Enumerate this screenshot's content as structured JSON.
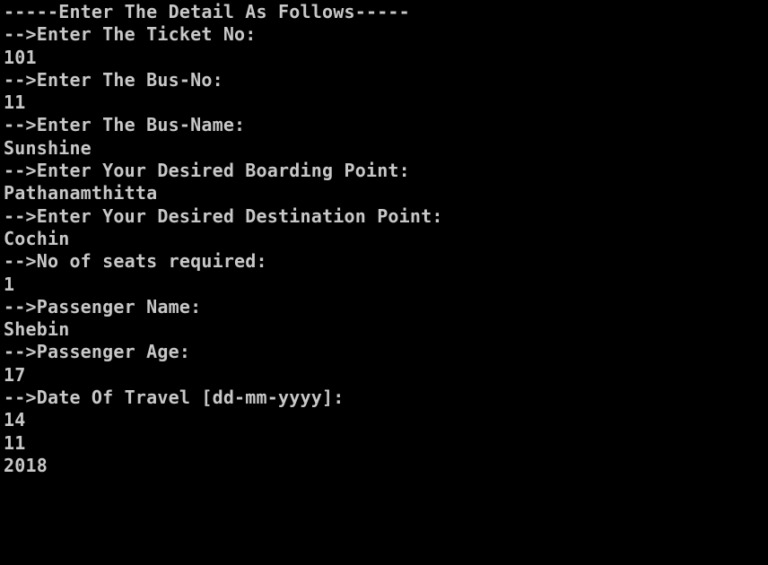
{
  "console": {
    "colors": {
      "background": "#000000",
      "text": "#c8c8c8"
    },
    "lines": [
      "-----Enter The Detail As Follows-----",
      "-->Enter The Ticket No:",
      "101",
      "-->Enter The Bus-No:",
      "11",
      "-->Enter The Bus-Name:",
      "Sunshine",
      "-->Enter Your Desired Boarding Point:",
      "Pathanamthitta",
      "-->Enter Your Desired Destination Point:",
      "Cochin",
      "-->No of seats required:",
      "1",
      "-->Passenger Name:",
      "Shebin",
      "-->Passenger Age:",
      "17",
      "-->Date Of Travel [dd-mm-yyyy]:",
      "14",
      "11",
      "2018"
    ]
  }
}
